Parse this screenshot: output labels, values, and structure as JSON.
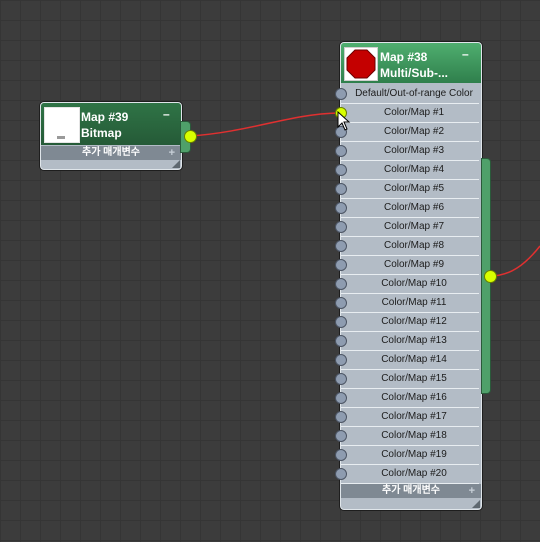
{
  "bitmap_node": {
    "title": "Map #39",
    "type": "Bitmap",
    "collapse_symbol": "–",
    "extra_params_label": "추가 매개변수",
    "expand_symbol": "+",
    "header_color": "#2a6a40",
    "thumbnail_icon": "bitmap-thumbnail"
  },
  "multisub_node": {
    "title": "Map #38",
    "type": "Multi/Sub-...",
    "collapse_symbol": "–",
    "extra_params_label": "추가 매개변수",
    "expand_symbol": "+",
    "header_color": "#3f9a5e",
    "thumbnail_icon": "stop-sign-icon",
    "slots": [
      {
        "label": "Default/Out-of-range Color",
        "connected": false
      },
      {
        "label": "Color/Map #1",
        "connected": true
      },
      {
        "label": "Color/Map #2",
        "connected": false
      },
      {
        "label": "Color/Map #3",
        "connected": false
      },
      {
        "label": "Color/Map #4",
        "connected": false
      },
      {
        "label": "Color/Map #5",
        "connected": false
      },
      {
        "label": "Color/Map #6",
        "connected": false
      },
      {
        "label": "Color/Map #7",
        "connected": false
      },
      {
        "label": "Color/Map #8",
        "connected": false
      },
      {
        "label": "Color/Map #9",
        "connected": false
      },
      {
        "label": "Color/Map #10",
        "connected": false
      },
      {
        "label": "Color/Map #11",
        "connected": false
      },
      {
        "label": "Color/Map #12",
        "connected": false
      },
      {
        "label": "Color/Map #13",
        "connected": false
      },
      {
        "label": "Color/Map #14",
        "connected": false
      },
      {
        "label": "Color/Map #15",
        "connected": false
      },
      {
        "label": "Color/Map #16",
        "connected": false
      },
      {
        "label": "Color/Map #17",
        "connected": false
      },
      {
        "label": "Color/Map #18",
        "connected": false
      },
      {
        "label": "Color/Map #19",
        "connected": false
      },
      {
        "label": "Color/Map #20",
        "connected": false
      }
    ]
  },
  "colors": {
    "wire": "#e03030",
    "active_port": "#d8ff00",
    "port": "#8e9cb0",
    "canvas_bg": "#3c3c3c"
  }
}
